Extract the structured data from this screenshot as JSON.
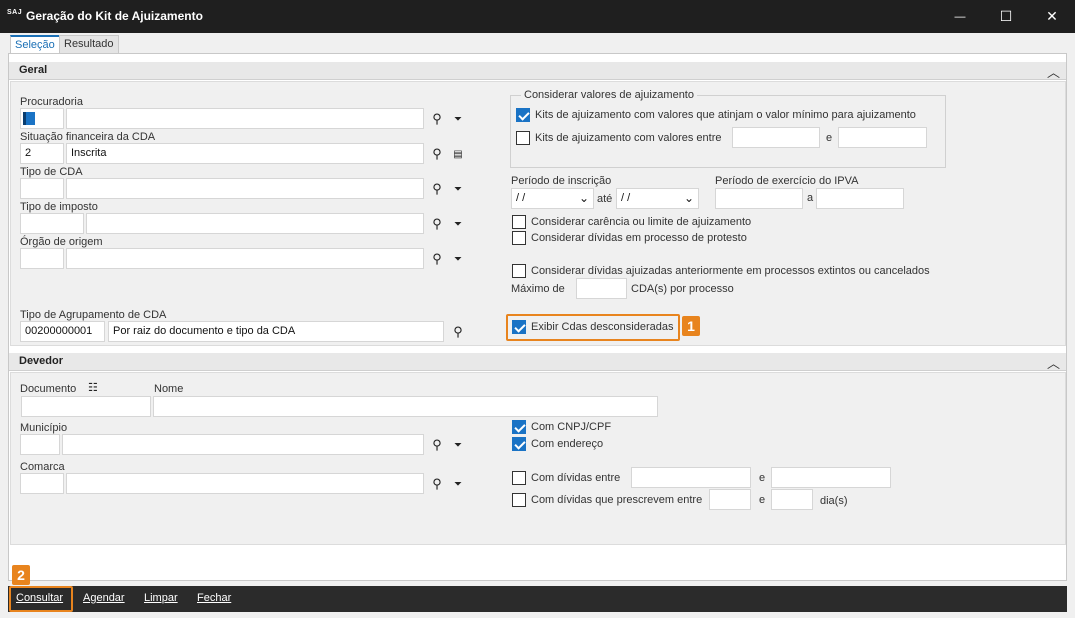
{
  "window": {
    "logo": "SAJ",
    "title": "Geração do Kit de Ajuizamento",
    "minimize": "—",
    "maximize": "☐",
    "close": "✕"
  },
  "tabs": [
    {
      "label": "Seleção",
      "active": true
    },
    {
      "label": "Resultado",
      "active": false
    }
  ],
  "geral": {
    "title": "Geral",
    "procuradoria": {
      "label": "Procuradoria",
      "code": "",
      "desc": ""
    },
    "situacao": {
      "label": "Situação financeira da CDA",
      "code": "2",
      "desc": "Inscrita"
    },
    "tipo_cda": {
      "label": "Tipo de CDA",
      "code": "",
      "desc": ""
    },
    "tipo_imposto": {
      "label": "Tipo de imposto",
      "code": "",
      "desc": ""
    },
    "orgao": {
      "label": "Órgão de origem",
      "code": "",
      "desc": ""
    },
    "agrupamento": {
      "label": "Tipo de Agrupamento de CDA",
      "code": "00200000001",
      "desc": "Por raiz do documento e tipo da CDA"
    },
    "valores_group": {
      "legend": "Considerar valores de ajuizamento",
      "kits_minimo": {
        "label": "Kits de ajuizamento com valores que atinjam o valor mínimo para ajuizamento",
        "checked": true
      },
      "kits_entre": {
        "label": "Kits de ajuizamento com valores entre",
        "checked": false,
        "from": "",
        "and": "e",
        "to": ""
      }
    },
    "periodo_inscricao": {
      "label": "Período de inscrição",
      "from": " / /",
      "ate": "até",
      "to": " / /"
    },
    "periodo_ipva": {
      "label": "Período de exercício do IPVA",
      "from": "",
      "a": "a",
      "to": ""
    },
    "carencia": {
      "label": "Considerar carência ou limite de ajuizamento",
      "checked": false
    },
    "protesto": {
      "label": "Considerar dívidas em processo de protesto",
      "checked": false
    },
    "extintos": {
      "label": "Considerar dívidas ajuizadas anteriormente em processos extintos ou cancelados",
      "checked": false
    },
    "maximo": {
      "label": "Máximo de",
      "value": "",
      "suffix": "CDA(s) por processo"
    },
    "exibir": {
      "label": "Exibir Cdas desconsideradas",
      "checked": true,
      "badge": "1"
    }
  },
  "devedor": {
    "title": "Devedor",
    "documento": {
      "label": "Documento",
      "value": ""
    },
    "nome": {
      "label": "Nome",
      "value": ""
    },
    "municipio": {
      "label": "Município",
      "code": "",
      "desc": ""
    },
    "comarca": {
      "label": "Comarca",
      "code": "",
      "desc": ""
    },
    "cnpj": {
      "label": "Com CNPJ/CPF",
      "checked": true
    },
    "endereco": {
      "label": "Com endereço",
      "checked": true
    },
    "dividas_entre": {
      "label": "Com dívidas entre",
      "checked": false,
      "from": "",
      "e": "e",
      "to": ""
    },
    "prescrevem": {
      "label": "Com dívidas que prescrevem entre",
      "checked": false,
      "from": "",
      "e": "e",
      "to": "",
      "suffix": "dia(s)"
    }
  },
  "bottom": {
    "badge": "2",
    "consultar": "Consultar",
    "agendar": "Agendar",
    "limpar": "Limpar",
    "fechar": "Fechar"
  },
  "colors": {
    "accent": "#1a73c5",
    "highlight": "#e8841e",
    "titlebar": "#1f1f1f"
  }
}
